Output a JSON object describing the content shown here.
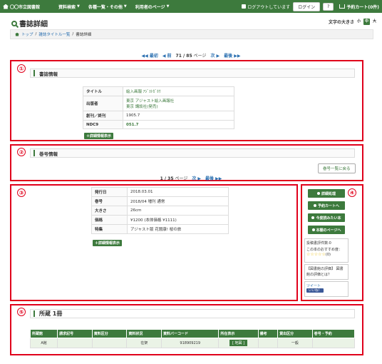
{
  "topbar": {
    "site_name": "〇〇市立図書館",
    "nav": [
      "資料検索",
      "各種一覧・その他",
      "利用者のページ"
    ],
    "login_status": "ログアウトしています",
    "login_button": "ログイン",
    "help_button": "?",
    "cart_label": "予約カート(0件)"
  },
  "page": {
    "title": "書誌詳細",
    "font_size_label": "文字の大きさ",
    "font_sizes": [
      "小",
      "中",
      "大"
    ]
  },
  "breadcrumb": [
    "トップ",
    "雑誌タイトル一覧",
    "書誌詳細"
  ],
  "pager_top": {
    "first": "最初",
    "prev": "前",
    "current": "71 / 85",
    "unit": "ページ",
    "next": "次",
    "last": "最後"
  },
  "section1": {
    "number": "①",
    "heading": "書誌情報",
    "rows": [
      {
        "key": "タイトル",
        "value": "絵入画報 ｱｼﾞｽﾄｶﾞﾎｳ"
      },
      {
        "key": "出版者",
        "value": "東京 アジャスト絵入画報社",
        "value2": "東京 講談社(発売)"
      },
      {
        "key": "創刊／終刊",
        "value": "1905.7"
      },
      {
        "key": "NDC9",
        "value": "051.7"
      }
    ],
    "detail_button": "＋詳細情報表示"
  },
  "section2": {
    "number": "②",
    "heading": "巻号情報",
    "back_button": "巻号一覧に戻る",
    "pager": {
      "current": "1 / 35",
      "unit": "ページ",
      "next": "次",
      "last": "最後"
    }
  },
  "section3": {
    "number": "③",
    "rows": [
      {
        "key": "発行日",
        "value": "2018.03.01"
      },
      {
        "key": "巻号",
        "value": "2018/04 増刊 通常"
      },
      {
        "key": "大きさ",
        "value": "26cm"
      },
      {
        "key": "価格",
        "value": "¥1200 (本体価格 ¥1111)"
      },
      {
        "key": "特集",
        "value": "アジャスト版 花闇康! 桜の旅"
      }
    ],
    "detail_button": "＋詳細情報表示"
  },
  "section4": {
    "number": "④",
    "buttons": [
      "詳細処理",
      "予約カートへ",
      "今度読みたい本",
      "本棚のページへ"
    ],
    "review_count": "投稿書評件数:0",
    "recommend_label": "この本のおすすめ度：",
    "stars": "☆☆☆☆☆",
    "star_count": "(0)",
    "review_link": "【図書館の評価】 図書館の評価とは？",
    "tweet": "ツイート",
    "like": "いいね！"
  },
  "section5": {
    "number": "⑤",
    "heading": "所蔵",
    "count": "1冊",
    "columns": [
      "所蔵館",
      "請求記号",
      "資料区分",
      "資料状況",
      "資料バーコード",
      "所在表示",
      "備考",
      "貸出区分",
      "巻号・予約"
    ],
    "rows": [
      [
        "A館",
        "",
        "",
        "在架",
        "918909219",
        "[ 地図 ]",
        "",
        "一般",
        ""
      ]
    ]
  },
  "colors": {
    "brand": "#3d7a3d",
    "highlight": "#e0001b"
  }
}
